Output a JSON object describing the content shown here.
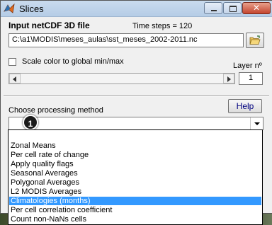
{
  "window": {
    "title": "Slices"
  },
  "input_section": {
    "heading": "Input netCDF 3D file",
    "time_steps": "Time steps = 120",
    "file_path": "C:\\a1\\MODIS\\meses_aulas\\sst_meses_2002-2011.nc"
  },
  "scale_option": {
    "label": "Scale color to global min/max",
    "checked": false
  },
  "layer": {
    "label": "Layer nº",
    "value": "1"
  },
  "processing": {
    "label": "Choose processing method",
    "selected_value": "",
    "help_label": "Help",
    "callout": "1",
    "options": [
      "",
      "Zonal Means",
      "Per cell rate of change",
      "Apply quality flags",
      "Seasonal Averages",
      "Polygonal Averages",
      "L2 MODIS Averages",
      "Climatologies (months)",
      "Per cell correlation coefficient",
      "Count non-NaNs cells"
    ],
    "highlighted_option": "Climatologies (months)"
  }
}
